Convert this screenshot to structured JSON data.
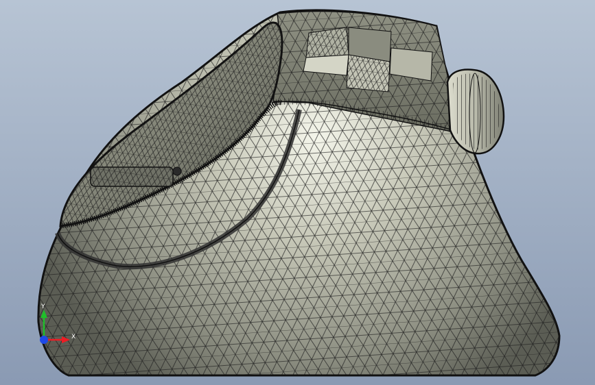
{
  "viewport": {
    "background_top": "#b7c4d4",
    "background_bottom": "#8a9ab3"
  },
  "model": {
    "body_light": "#f4f5ea",
    "body_mid": "#a9ab9c",
    "body_dark": "#5b5d54",
    "edge_color": "#111111",
    "mesh_color": "#1e1e1e"
  },
  "triad": {
    "x_label": "X",
    "y_label": "Y",
    "x_color": "#ee1c24",
    "y_color": "#1fbf2a",
    "z_color": "#1e49e8",
    "x_axis_icon": "x-axis-arrow-icon",
    "y_axis_icon": "y-axis-arrow-icon",
    "origin_icon": "z-axis-dot-icon"
  }
}
